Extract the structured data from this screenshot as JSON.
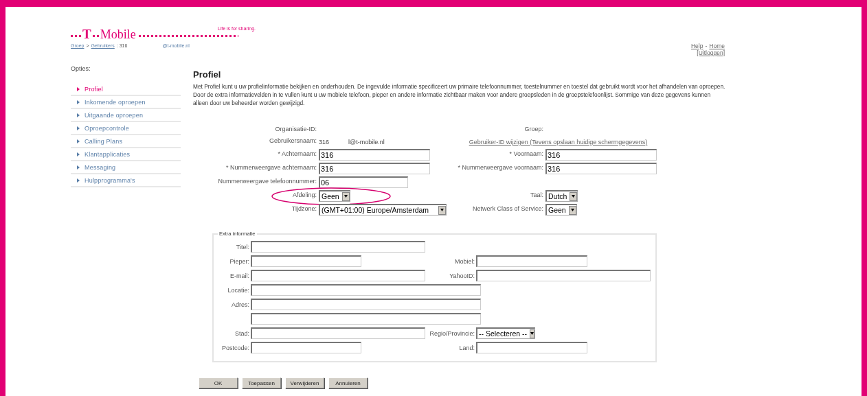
{
  "header": {
    "logo": {
      "mark": "T",
      "wordmark": "Mobile"
    },
    "tagline": "Life is for sharing.",
    "breadcrumb": [
      {
        "kind": "link",
        "text": "Groep"
      },
      {
        "kind": "text",
        "text": ">"
      },
      {
        "kind": "link",
        "text": "Gebruikers"
      },
      {
        "kind": "text",
        "text": ": 316"
      },
      {
        "kind": "domain",
        "text": "@t-mobile.nl"
      }
    ],
    "top_links": [
      [
        {
          "kind": "link",
          "text": "Help"
        },
        {
          "kind": "text",
          "text": "-"
        },
        {
          "kind": "link",
          "text": "Home"
        }
      ],
      [
        {
          "kind": "link",
          "text": "[Uitloggen]"
        }
      ]
    ]
  },
  "sidebar": {
    "title": "Opties:",
    "items": [
      {
        "label": "Profiel",
        "selected": true
      },
      {
        "label": "Inkomende oproepen",
        "selected": false
      },
      {
        "label": "Uitgaande oproepen",
        "selected": false
      },
      {
        "label": "Oproepcontrole",
        "selected": false
      },
      {
        "label": "Calling Plans",
        "selected": false
      },
      {
        "label": "Klantapplicaties",
        "selected": false
      },
      {
        "label": "Messaging",
        "selected": false
      },
      {
        "label": "Hulpprogramma's",
        "selected": false
      }
    ]
  },
  "content": {
    "title": "Profiel",
    "intro": "Met Profiel kunt u uw profielinformatie bekijken en onderhouden. De ingevulde informatie specificeert uw primaire telefoonnummer, toestelnummer en toestel dat gebruikt wordt voor het afhandelen van oproepen. Door de extra informatievelden in te vullen kunt u uw mobiele telefoon, pieper en andere informatie zichtbaar maken voor andere groepsleden in de groepstelefoonlijst. Sommige van deze gegevens kunnen alleen door uw beheerder worden gewijzigd."
  },
  "form": {
    "rows": [
      {
        "left": {
          "kind": "static",
          "label": "Organisatie-ID:"
        },
        "right": {
          "kind": "static",
          "label": "Groep:"
        }
      },
      {
        "left": {
          "kind": "static",
          "label": "Gebruikersnaam:",
          "values": [
            "316",
            "l@t-mobile.nl"
          ]
        },
        "right": {
          "kind": "link",
          "text": "Gebruiker-ID wijzigen (Tevens opslaan huidige schermgegevens)"
        }
      },
      {
        "left": {
          "kind": "input",
          "label": "* Achternaam:",
          "value": "316"
        },
        "right": {
          "kind": "input",
          "label": "* Voornaam:",
          "value": "316"
        }
      },
      {
        "left": {
          "kind": "input",
          "label": "* Nummerweergave achternaam:",
          "value": "316"
        },
        "right": {
          "kind": "input",
          "label": "* Nummerweergave voornaam:",
          "value": "316"
        }
      },
      {
        "left": {
          "kind": "input",
          "label": "Nummerweergave telefoonnummer:",
          "value": "06"
        }
      },
      {
        "left": {
          "kind": "select",
          "label": "Afdeling:",
          "value": "Geen",
          "highlighted": true
        },
        "right": {
          "kind": "select",
          "label": "Taal:",
          "value": "Dutch"
        }
      },
      {
        "left": {
          "kind": "select",
          "label": "Tijdzone:",
          "value": "(GMT+01:00) Europe/Amsterdam"
        },
        "right": {
          "kind": "select",
          "label": "Netwerk Class of Service:",
          "value": "Geen"
        }
      }
    ]
  },
  "extra": {
    "legend": "Extra informatie",
    "rows": [
      {
        "left": {
          "kind": "input",
          "label": "Titel:"
        }
      },
      {
        "left": {
          "kind": "input",
          "label": "Pieper:"
        },
        "right": {
          "kind": "input",
          "label": "Mobiel:"
        }
      },
      {
        "left": {
          "kind": "input",
          "label": "E-mail:"
        },
        "right": {
          "kind": "input",
          "label": "YahooID:"
        }
      },
      {
        "left": {
          "kind": "input",
          "label": "Locatie:"
        }
      },
      {
        "left": {
          "kind": "input",
          "label": "Adres:"
        }
      },
      {
        "left": {
          "kind": "input"
        }
      },
      {
        "left": {
          "kind": "input",
          "label": "Stad:"
        },
        "right": {
          "kind": "select",
          "label": "Regio/Provincie:",
          "value": "-- Selecteren --"
        }
      },
      {
        "left": {
          "kind": "input",
          "label": "Postcode:"
        },
        "right": {
          "kind": "input",
          "label": "Land:"
        }
      }
    ]
  },
  "buttons": [
    "OK",
    "Toepassen",
    "Verwijderen",
    "Annuleren"
  ]
}
